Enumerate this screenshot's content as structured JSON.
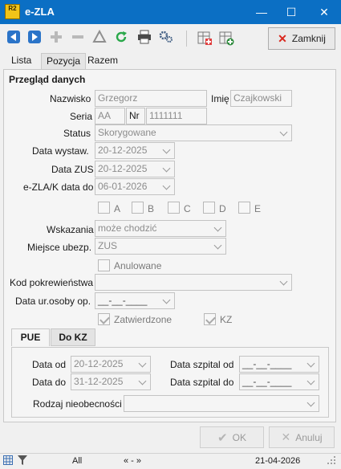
{
  "window": {
    "logo_text": "R2",
    "title": "e-ZLA",
    "min_glyph": "—",
    "max_glyph": "☐",
    "close_glyph": "✕"
  },
  "toolbar": {
    "close_label": "Zamknij",
    "icons": [
      "arrow-left-icon",
      "arrow-right-icon",
      "plus-icon",
      "minus-icon",
      "delta-icon",
      "refresh-icon",
      "print-icon",
      "settings-icon",
      "grid-add-icon",
      "grid-new-icon"
    ]
  },
  "tabs": [
    "Lista",
    "Pozycja",
    "Razem"
  ],
  "section_title": "Przegląd danych",
  "form": {
    "nazwisko_label": "Nazwisko",
    "nazwisko_value": "Grzegorz",
    "imie_label": "Imię",
    "imie_value": "Czajkowski",
    "seria_label": "Seria",
    "seria_value": "AA",
    "nr_label": "Nr",
    "nr_value": "1111111",
    "status_label": "Status",
    "status_value": "Skorygowane",
    "data_wystaw_label": "Data wystaw.",
    "data_wystaw_value": "20-12-2025",
    "data_zus_label": "Data ZUS",
    "data_zus_value": "20-12-2025",
    "ezla_k_label": "e-ZLA/K data do",
    "ezla_k_value": "06-01-2026",
    "checks": [
      "A",
      "B",
      "C",
      "D",
      "E"
    ],
    "wskazania_label": "Wskazania",
    "wskazania_value": "może chodzić",
    "miejsce_label": "Miejsce ubezp.",
    "miejsce_value": "ZUS",
    "anulowane_label": "Anulowane",
    "kod_label": "Kod pokrewieństwa",
    "kod_value": "",
    "data_ur_label": "Data ur.osoby op.",
    "data_ur_value": "__-__-____",
    "zatwierdzone_label": "Zatwierdzone",
    "kz_label": "KZ"
  },
  "subtabs": [
    "PUE",
    "Do KZ"
  ],
  "pue": {
    "data_od_label": "Data od",
    "data_od_value": "20-12-2025",
    "data_do_label": "Data do",
    "data_do_value": "31-12-2025",
    "szpital_od_label": "Data szpital od",
    "szpital_od_value": "__-__-____",
    "szpital_do_label": "Data szpital do",
    "szpital_do_value": "__-__-____",
    "rodzaj_label": "Rodzaj nieobecności",
    "rodzaj_value": ""
  },
  "footer": {
    "ok_label": "OK",
    "anuluj_label": "Anuluj"
  },
  "statusbar": {
    "filter_text": "All",
    "nav_text": "« - »",
    "date": "21-04-2026"
  }
}
